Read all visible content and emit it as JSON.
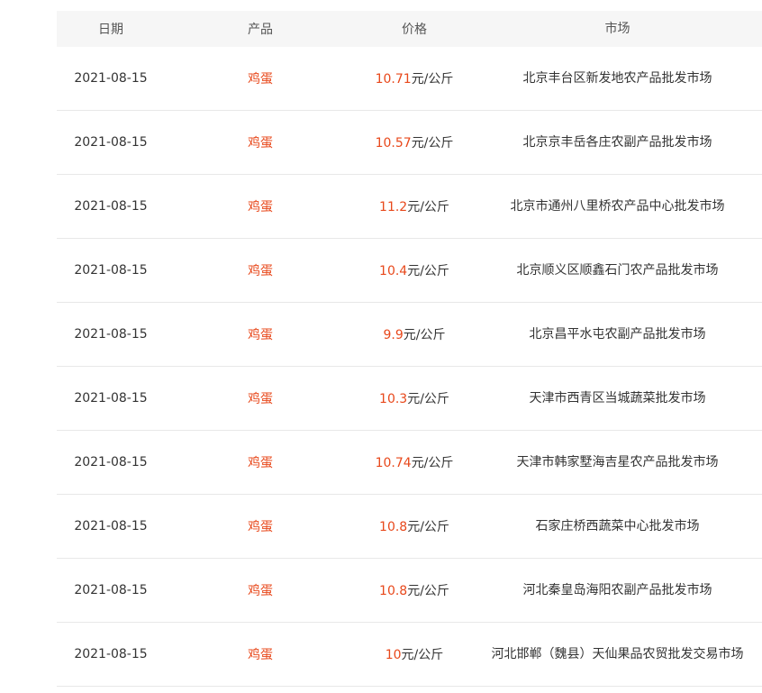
{
  "table": {
    "headers": {
      "date": "日期",
      "product": "产品",
      "price": "价格",
      "market": "市场"
    },
    "rows": [
      {
        "date": "2021-08-15",
        "product": "鸡蛋",
        "price": "10.71",
        "unit": "元/公斤",
        "market": "北京丰台区新发地农产品批发市场"
      },
      {
        "date": "2021-08-15",
        "product": "鸡蛋",
        "price": "10.57",
        "unit": "元/公斤",
        "market": "北京京丰岳各庄农副产品批发市场"
      },
      {
        "date": "2021-08-15",
        "product": "鸡蛋",
        "price": "11.2",
        "unit": "元/公斤",
        "market": "北京市通州八里桥农产品中心批发市场"
      },
      {
        "date": "2021-08-15",
        "product": "鸡蛋",
        "price": "10.4",
        "unit": "元/公斤",
        "market": "北京顺义区顺鑫石门农产品批发市场"
      },
      {
        "date": "2021-08-15",
        "product": "鸡蛋",
        "price": "9.9",
        "unit": "元/公斤",
        "market": "北京昌平水屯农副产品批发市场"
      },
      {
        "date": "2021-08-15",
        "product": "鸡蛋",
        "price": "10.3",
        "unit": "元/公斤",
        "market": "天津市西青区当城蔬菜批发市场"
      },
      {
        "date": "2021-08-15",
        "product": "鸡蛋",
        "price": "10.74",
        "unit": "元/公斤",
        "market": "天津市韩家墅海吉星农产品批发市场"
      },
      {
        "date": "2021-08-15",
        "product": "鸡蛋",
        "price": "10.8",
        "unit": "元/公斤",
        "market": "石家庄桥西蔬菜中心批发市场"
      },
      {
        "date": "2021-08-15",
        "product": "鸡蛋",
        "price": "10.8",
        "unit": "元/公斤",
        "market": "河北秦皇岛海阳农副产品批发市场"
      },
      {
        "date": "2021-08-15",
        "product": "鸡蛋",
        "price": "10",
        "unit": "元/公斤",
        "market": "河北邯郸（魏县）天仙果品农贸批发交易市场"
      }
    ]
  },
  "colors": {
    "accent": "#e8481b",
    "header_bg": "#f6f6f6",
    "divider": "#e8e8e8"
  }
}
